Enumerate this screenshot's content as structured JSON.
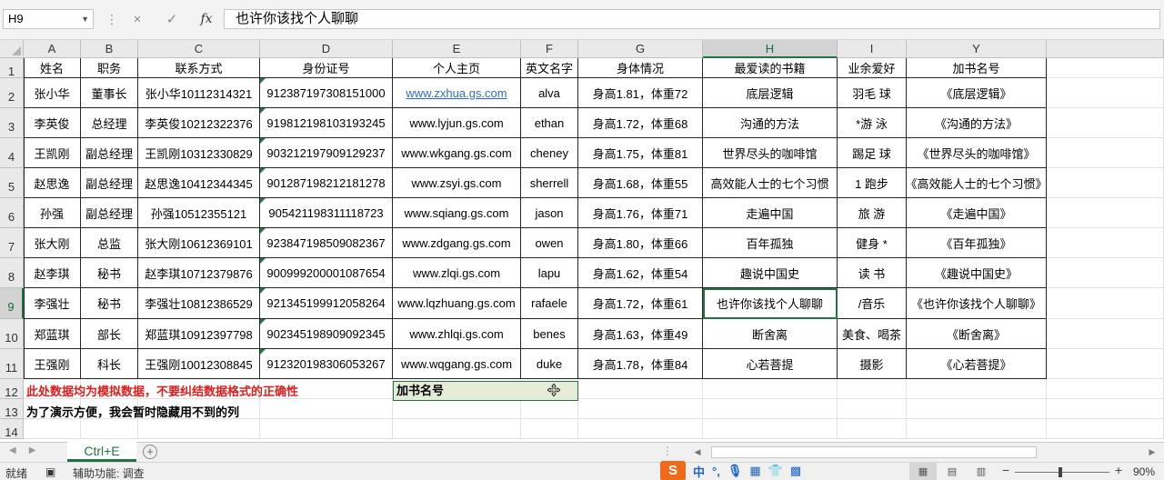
{
  "formula_bar": {
    "name_box": "H9",
    "cancel_icon": "×",
    "enter_icon": "✓",
    "function_label": "fx",
    "formula": "也许你该找个人聊聊"
  },
  "columns": [
    "A",
    "B",
    "C",
    "D",
    "E",
    "F",
    "G",
    "H",
    "I",
    "Y"
  ],
  "selected_column": "H",
  "selected_row": "9",
  "rows": [
    "1",
    "2",
    "3",
    "4",
    "5",
    "6",
    "7",
    "8",
    "9",
    "10",
    "11",
    "12",
    "13",
    "14"
  ],
  "table": {
    "headers": [
      "姓名",
      "职务",
      "联系方式",
      "身份证号",
      "个人主页",
      "英文名字",
      "身体情况",
      "最爱读的书籍",
      "业余爱好",
      "加书名号"
    ],
    "rows": [
      [
        "张小华",
        "董事长",
        "张小华10112314321",
        "912387197308151000",
        "www.zxhua.gs.com",
        "alva",
        "身高1.81，体重72",
        "底层逻辑",
        "羽毛  球",
        "《底层逻辑》"
      ],
      [
        "李英俊",
        "总经理",
        "李英俊10212322376",
        "919812198103193245",
        "www.lyjun.gs.com",
        "ethan",
        "身高1.72，体重68",
        "沟通的方法",
        "*游 泳",
        "《沟通的方法》"
      ],
      [
        "王凯刚",
        "副总经理",
        "王凯刚10312330829",
        "903212197909129237",
        "www.wkgang.gs.com",
        "cheney",
        "身高1.75，体重81",
        "世界尽头的咖啡馆",
        "踢足  球",
        "《世界尽头的咖啡馆》"
      ],
      [
        "赵思逸",
        "副总经理",
        "赵思逸10412344345",
        "901287198212181278",
        "www.zsyi.gs.com",
        "sherrell",
        "身高1.68，体重55",
        "高效能人士的七个习惯",
        "1 跑步",
        "《高效能人士的七个习惯》"
      ],
      [
        "孙强",
        "副总经理",
        "孙强10512355121",
        "905421198311118723",
        "www.sqiang.gs.com",
        "jason",
        "身高1.76，体重71",
        "走遍中国",
        "旅   游",
        "《走遍中国》"
      ],
      [
        "张大刚",
        "总监",
        "张大刚10612369101",
        "923847198509082367",
        "www.zdgang.gs.com",
        "owen",
        "身高1.80，体重66",
        "百年孤独",
        "健身 *",
        "《百年孤独》"
      ],
      [
        "赵李琪",
        "秘书",
        "赵李琪10712379876",
        "900999200001087654",
        "www.zlqi.gs.com",
        "lapu",
        "身高1.62，体重54",
        "趣说中国史",
        "读 书",
        "《趣说中国史》"
      ],
      [
        "李强壮",
        "秘书",
        "李强壮10812386529",
        "921345199912058264",
        "www.lqzhuang.gs.com",
        "rafaele",
        "身高1.72，体重61",
        "也许你该找个人聊聊",
        "/音乐",
        "《也许你该找个人聊聊》"
      ],
      [
        "郑蓝琪",
        "部长",
        "郑蓝琪10912397798",
        "902345198909092345",
        "www.zhlqi.gs.com",
        "benes",
        "身高1.63，体重49",
        "断舍离",
        "美食、喝茶",
        "《断舍离》"
      ],
      [
        "王强刚",
        "科长",
        "王强刚10012308845",
        "912320198306053267",
        "www.wqgang.gs.com",
        "duke",
        "身高1.78，体重84",
        "心若菩提",
        "摄影",
        "《心若菩提》"
      ]
    ]
  },
  "notes": {
    "row12": "此处数据均为模拟数据，不要纠结数据格式的正确性",
    "row13": "为了演示方便，我会暂时隐藏用不到的列",
    "e12": "加书名号"
  },
  "sheet_tab": "Ctrl+E",
  "add_sheet": "+",
  "status_bar": {
    "ready": "就绪",
    "accessibility": "辅助功能: 调查",
    "ime_logo": "S",
    "ime_mode": "中",
    "zoom": "90%"
  },
  "colors": {
    "accent": "#217346",
    "link": "#2e6db8",
    "note_red": "#e01b1b",
    "e12_fill": "#e4ecd8"
  }
}
